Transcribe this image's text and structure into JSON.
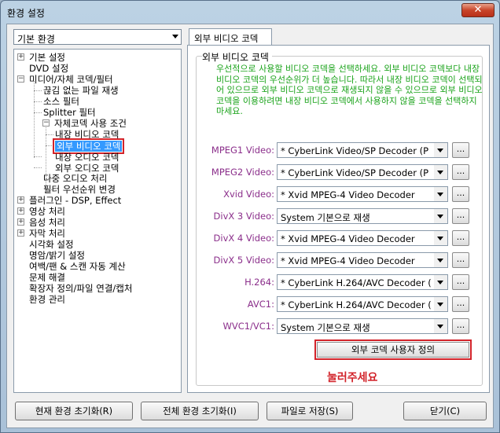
{
  "window": {
    "title": "환경 설정",
    "close_glyph": "✕"
  },
  "profile_combo": {
    "value": "기본 환경"
  },
  "tree": {
    "items": [
      {
        "label": "기본 설정"
      },
      {
        "label": "DVD 설정"
      },
      {
        "label": "미디어/자체 코덱/필터"
      },
      {
        "label": "끊김 없는 파일 재생"
      },
      {
        "label": "소스 필터"
      },
      {
        "label": "Splitter 필터"
      },
      {
        "label": "자체코덱 사용 조건"
      },
      {
        "label": "내장 비디오 코덱"
      },
      {
        "label": "외부 비디오 코덱"
      },
      {
        "label": "내장 오디오 코덱"
      },
      {
        "label": "외부 오디오 코덱"
      },
      {
        "label": "다중 오디오 처리"
      },
      {
        "label": "필터 우선순위 변경"
      },
      {
        "label": "플러그인 - DSP, Effect"
      },
      {
        "label": "영상 처리"
      },
      {
        "label": "음성 처리"
      },
      {
        "label": "자막 처리"
      },
      {
        "label": "시각화 설정"
      },
      {
        "label": "명암/밝기 설정"
      },
      {
        "label": "여백/팬 & 스캔 자동 계산"
      },
      {
        "label": "문제 해결"
      },
      {
        "label": "확장자 정의/파일 연결/캡처"
      },
      {
        "label": "환경 관리"
      }
    ]
  },
  "tab": {
    "label": "외부 비디오 코덱"
  },
  "group": {
    "title": "외부 비디오 코덱",
    "description": "우선적으로 사용할 비디오 코덱을 선택하세요. 외부 비디오 코덱보다 내장 비디오 코덱의 우선순위가 더 높습니다. 따라서 내장 비디오 코덱이 선택되어 있으므로 외부 비디오 코덱으로 재생되지 않을 수 있으므로 외부 비디오 코덱을 이용하려면 내장 비디오 코덱에서 사용하지 않을 코덱을 선택하지 마세요."
  },
  "codecs": [
    {
      "label": "MPEG1 Video:",
      "value": "* CyberLink Video/SP Decoder (P"
    },
    {
      "label": "MPEG2 Video:",
      "value": "* CyberLink Video/SP Decoder (P"
    },
    {
      "label": "Xvid Video:",
      "value": "* Xvid MPEG-4 Video Decoder"
    },
    {
      "label": "DivX 3 Video:",
      "value": "System 기본으로 재생"
    },
    {
      "label": "DivX 4 Video:",
      "value": "* Xvid MPEG-4 Video Decoder"
    },
    {
      "label": "DivX 5 Video:",
      "value": "* Xvid MPEG-4 Video Decoder"
    },
    {
      "label": "H.264:",
      "value": "* CyberLink H.264/AVC Decoder ("
    },
    {
      "label": "AVC1:",
      "value": "* CyberLink H.264/AVC Decoder ("
    },
    {
      "label": "WVC1/VC1:",
      "value": "System 기본으로 재생"
    }
  ],
  "more_label": "...",
  "custom_button": "외부 코덱 사용자 정의",
  "note": "눌러주세요",
  "footer": {
    "reset_current": "현재 환경 초기화(R)",
    "reset_all": "전체 환경 초기화(I)",
    "save_file": "파일로 저장(S)",
    "close": "닫기(C)"
  },
  "colors": {
    "accent_red": "#d2232a",
    "desc_green": "#1aa31a",
    "label_purple": "#8b2f8b",
    "selection_blue": "#3399ff"
  }
}
